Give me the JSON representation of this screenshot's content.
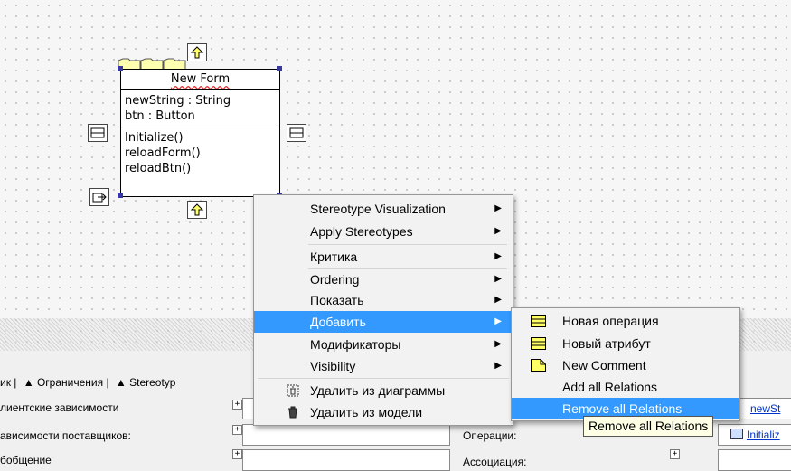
{
  "class_box": {
    "name": "New Form",
    "attributes": [
      "newString : String",
      "btn : Button"
    ],
    "operations": [
      "Initialize()",
      "reloadForm()",
      "reloadBtn()"
    ]
  },
  "context_menu": {
    "items": [
      {
        "label": "Stereotype Visualization",
        "submenu": true
      },
      {
        "label": "Apply Stereotypes",
        "submenu": true
      },
      {
        "label": "Критика",
        "submenu": true
      },
      {
        "label": "Ordering",
        "submenu": true
      },
      {
        "label": "Показать",
        "submenu": true
      },
      {
        "label": "Добавить",
        "submenu": true,
        "highlighted": true
      },
      {
        "label": "Модификаторы",
        "submenu": true
      },
      {
        "label": "Visibility",
        "submenu": true
      },
      {
        "label": "Удалить из диаграммы",
        "icon": "delete-from-diagram-icon"
      },
      {
        "label": "Удалить из модели",
        "icon": "trash-icon"
      }
    ]
  },
  "submenu": {
    "items": [
      {
        "label": "Новая операция",
        "icon": "new-operation-icon"
      },
      {
        "label": "Новый атрибут",
        "icon": "new-attribute-icon"
      },
      {
        "label": "New Comment",
        "icon": "comment-icon"
      },
      {
        "label": "Add all Relations"
      },
      {
        "label": "Remove all Relations",
        "highlighted": true
      }
    ]
  },
  "tooltip": "Remove all Relations",
  "bottom_panel": {
    "tabs": [
      "ик |",
      "▲ Ограничения |",
      "▲ Stereotyp"
    ],
    "rows": [
      "лиентские зависимости",
      "ависимости поставщиков:",
      "бобщение"
    ],
    "right_labels": [
      "Операции:",
      "Ассоциация:"
    ],
    "links": [
      "newSt",
      "Initializ"
    ]
  },
  "colors": {
    "highlight": "#3399ff",
    "handle": "#3838a0",
    "tooltip_bg": "#ffffe6"
  }
}
